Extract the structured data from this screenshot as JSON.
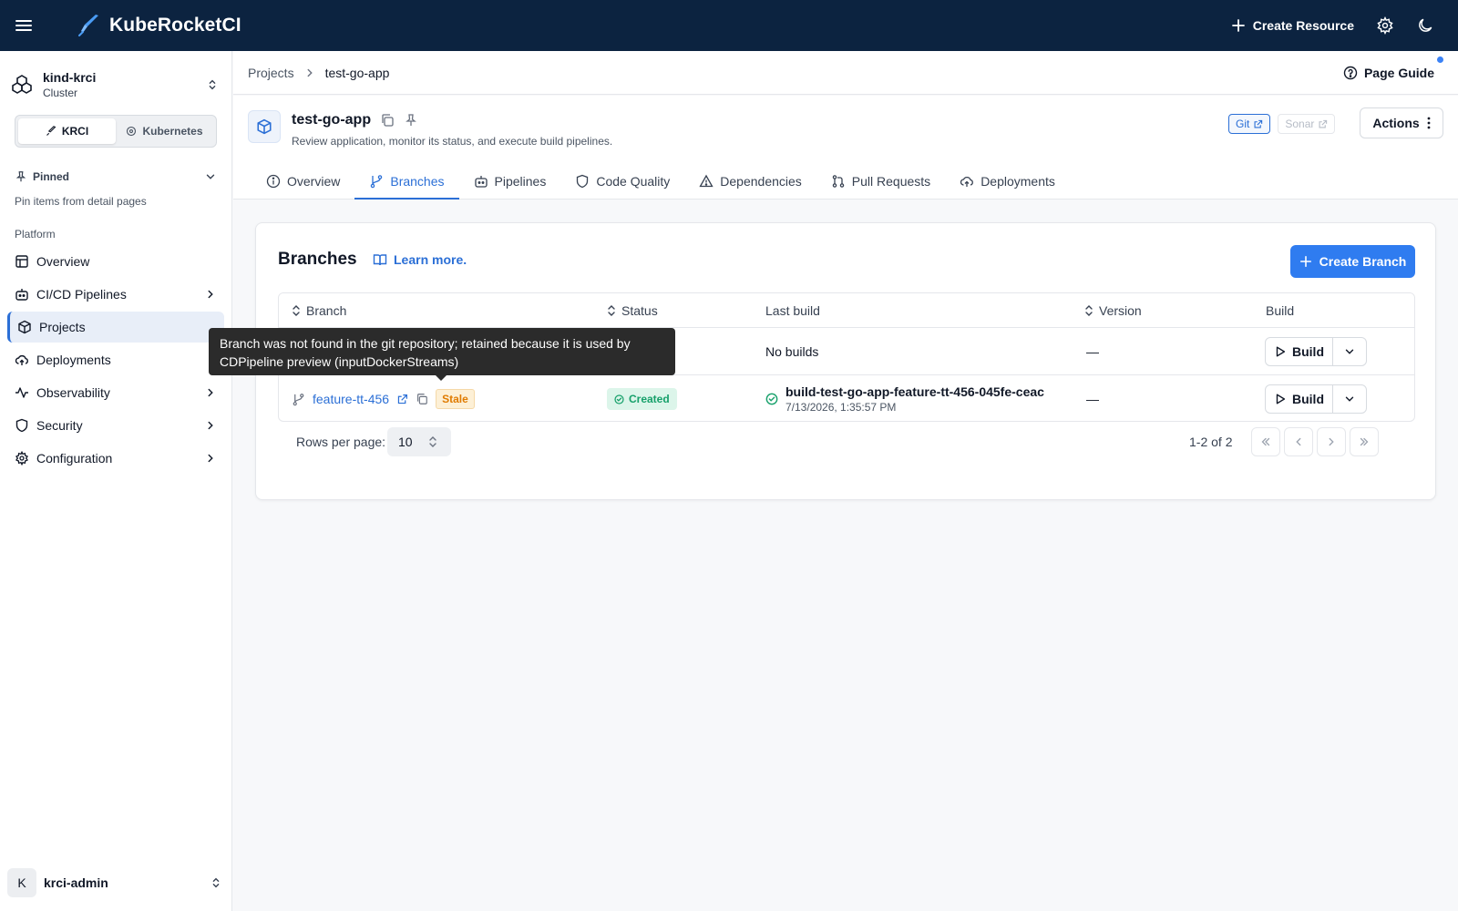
{
  "topbar": {
    "app_name": "KubeRocketCI",
    "create_resource_label": "Create Resource"
  },
  "sidebar": {
    "cluster_name": "kind-krci",
    "cluster_type": "Cluster",
    "mode_options": [
      "KRCI",
      "Kubernetes"
    ],
    "pinned_label": "Pinned",
    "pinned_hint": "Pin items from detail pages",
    "section_label": "Platform",
    "items": [
      {
        "label": "Overview",
        "icon": "layout-icon",
        "has_children": false,
        "active": false
      },
      {
        "label": "CI/CD Pipelines",
        "icon": "bot-icon",
        "has_children": true,
        "active": false
      },
      {
        "label": "Projects",
        "icon": "box-icon",
        "has_children": false,
        "active": true
      },
      {
        "label": "Deployments",
        "icon": "cloud-upload-icon",
        "has_children": false,
        "active": false
      },
      {
        "label": "Observability",
        "icon": "activity-icon",
        "has_children": true,
        "active": false
      },
      {
        "label": "Security",
        "icon": "shield-icon",
        "has_children": true,
        "active": false
      },
      {
        "label": "Configuration",
        "icon": "gear-icon",
        "has_children": true,
        "active": false
      }
    ],
    "user_initial": "K",
    "user_name": "krci-admin"
  },
  "breadcrumb": {
    "items": [
      "Projects",
      "test-go-app"
    ],
    "page_guide_label": "Page Guide"
  },
  "header": {
    "title": "test-go-app",
    "description": "Review application, monitor its status, and execute build pipelines.",
    "links": [
      "Git",
      "Sonar"
    ],
    "actions_label": "Actions",
    "tabs": [
      "Overview",
      "Branches",
      "Pipelines",
      "Code Quality",
      "Dependencies",
      "Pull Requests",
      "Deployments"
    ],
    "active_tab": "Branches"
  },
  "branches": {
    "title": "Branches",
    "learn_more": "Learn more.",
    "create_label": "Create Branch",
    "columns": [
      "Branch",
      "Status",
      "Last build",
      "Version",
      "Build"
    ],
    "rows": [
      {
        "branch": "",
        "stale": "",
        "status": "",
        "last_build": "No builds",
        "build_date": "",
        "version": "—",
        "build_label": "Build"
      },
      {
        "branch": "feature-tt-456",
        "stale": "Stale",
        "status": "Created",
        "last_build": "build-test-go-app-feature-tt-456-045fe-ceac",
        "build_date": "7/13/2026, 1:35:57 PM",
        "version": "—",
        "build_label": "Build"
      }
    ],
    "rows_per_page_label": "Rows per page:",
    "rows_per_page": "10",
    "range": "1-2 of 2"
  },
  "tooltip": {
    "text": "Branch was not found in the git repository; retained because it is used by CDPipeline preview (inputDockerStreams)"
  },
  "colors": {
    "topbar": "#0c2340",
    "accent": "#2f7cf0",
    "stale": "#e07b00",
    "success": "#16a06a"
  }
}
